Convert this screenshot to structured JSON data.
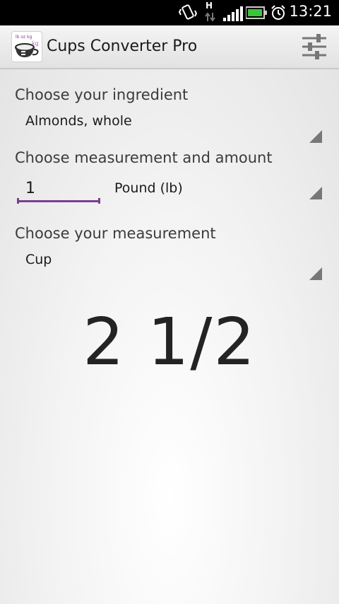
{
  "statusbar": {
    "time": "13:21",
    "network_type": "H",
    "icons": [
      "vibrate-icon",
      "data-transfer-icon",
      "signal-icon",
      "battery-icon",
      "alarm-icon"
    ]
  },
  "app": {
    "title": "Cups Converter Pro",
    "icon": "app-cup-icon",
    "icon_text": "lb oz kg",
    "menu_icon": "settings-sliders-icon"
  },
  "form": {
    "ingredient_label": "Choose your ingredient",
    "ingredient_value": "Almonds, whole",
    "measurement_label": "Choose measurement and amount",
    "amount_value": "1",
    "from_unit_value": "Pound (lb)",
    "target_label": "Choose your measurement",
    "target_value": "Cup"
  },
  "result": {
    "value": "2 1/2"
  },
  "colors": {
    "accent": "#7b3f8d",
    "text": "#232323"
  }
}
